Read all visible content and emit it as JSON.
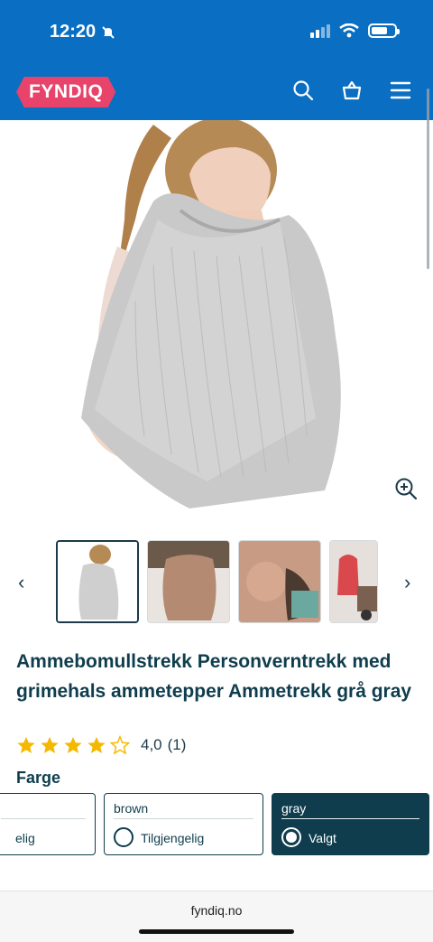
{
  "status": {
    "time": "12:20"
  },
  "header": {
    "logo": "FYNDIQ",
    "icons": [
      "search-icon",
      "basket-icon",
      "menu-icon"
    ]
  },
  "product": {
    "title": "Ammebomullstrekk Personverntrekk med grimehals ammetepper Ammetrekk grå gray",
    "rating_value": 4.0,
    "rating_text": "4,0",
    "review_count": "(1)"
  },
  "color_section": {
    "label": "Farge",
    "variants": [
      {
        "name": "",
        "status": "elig",
        "selected": false
      },
      {
        "name": "brown",
        "status": "Tilgjengelig",
        "selected": false
      },
      {
        "name": "gray",
        "status": "Valgt",
        "selected": true
      }
    ]
  },
  "browser": {
    "url": "fyndiq.no"
  },
  "colors": {
    "header_bg": "#0a6fc2",
    "logo_bg": "#e8436a",
    "text": "#0f3d4d",
    "star": "#f5b800"
  }
}
